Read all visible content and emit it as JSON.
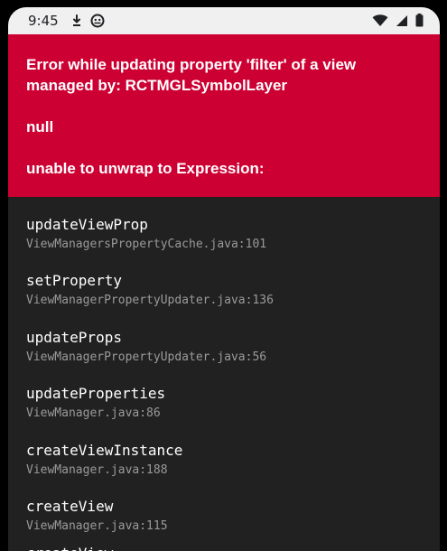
{
  "status_bar": {
    "time": "9:45",
    "left_icons": [
      "download-icon",
      "android-debug-icon"
    ],
    "right_icons": [
      "wifi-icon",
      "cell-signal-icon",
      "battery-icon"
    ]
  },
  "error": {
    "message": "Error while updating property 'filter' of a view managed by: RCTMGLSymbolLayer",
    "detail": "null",
    "reason": "unable to unwrap to Expression:",
    "background_color": "#cc0033"
  },
  "stack_trace": [
    {
      "method": "updateViewProp",
      "location": "ViewManagersPropertyCache.java:101"
    },
    {
      "method": "setProperty",
      "location": "ViewManagerPropertyUpdater.java:136"
    },
    {
      "method": "updateProps",
      "location": "ViewManagerPropertyUpdater.java:56"
    },
    {
      "method": "updateProperties",
      "location": "ViewManager.java:86"
    },
    {
      "method": "createViewInstance",
      "location": "ViewManager.java:188"
    },
    {
      "method": "createView",
      "location": "ViewManager.java:115"
    },
    {
      "method": "createView",
      "location": ""
    }
  ]
}
